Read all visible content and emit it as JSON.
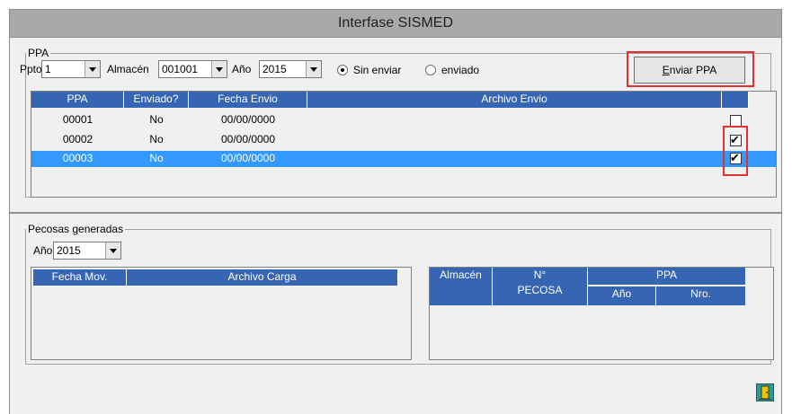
{
  "window": {
    "title": "Interfase SISMED"
  },
  "ppa_section": {
    "legend": "PPA",
    "ppto_label": "Ppto",
    "ppto_value": "1",
    "almacen_label": "Almacén",
    "almacen_value": "001001",
    "anio_label": "Año",
    "anio_value": "2015",
    "radio_sin_enviar": "Sin enviar",
    "radio_enviado": "enviado",
    "selected_radio": "Sin enviar",
    "enviar_button_key": "E",
    "enviar_button_rest": "nviar PPA",
    "columns": [
      "PPA",
      "Enviado?",
      "Fecha Envio",
      "Archivo Envio",
      ""
    ],
    "rows": [
      {
        "ppa": "00001",
        "enviado": "No",
        "fecha": "00/00/0000",
        "archivo": "",
        "checked": false,
        "selected": false
      },
      {
        "ppa": "00002",
        "enviado": "No",
        "fecha": "00/00/0000",
        "archivo": "",
        "checked": true,
        "selected": false
      },
      {
        "ppa": "00003",
        "enviado": "No",
        "fecha": "00/00/0000",
        "archivo": "",
        "checked": true,
        "selected": true
      }
    ]
  },
  "pecosas_section": {
    "legend": "Pecosas generadas",
    "anio_label": "Año",
    "anio_value": "2015",
    "left_columns": [
      "Fecha Mov.",
      "Archivo Carga"
    ],
    "right_columns": {
      "almacen": "Almacén",
      "pecosa_n": "N°",
      "pecosa": "PECOSA",
      "ppa": "PPA",
      "anio": "Año",
      "nro": "Nro."
    }
  },
  "colors": {
    "header_blue": "#3565b3",
    "selected_row": "#3399ff",
    "highlight_red": "#e03030"
  },
  "icons": {
    "exit": "exit-door-icon",
    "dropdown": "chevron-down-icon"
  }
}
